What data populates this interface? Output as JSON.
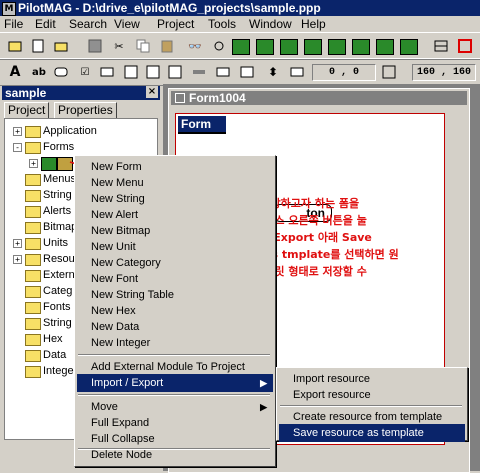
{
  "window": {
    "title": "PilotMAG - D:\\drive_e\\pilotMAG_projects\\sample.ppp"
  },
  "menubar": [
    "File",
    "Edit",
    "Search",
    "View",
    "Project",
    "Tools",
    "Window",
    "Help"
  ],
  "toolbar2": {
    "coord1": "0 , 0",
    "coord2": "160 , 160"
  },
  "panel": {
    "title": "sample",
    "tabs": [
      "Project",
      "Properties"
    ],
    "tree": [
      "Application",
      "Forms",
      "",
      "Menus",
      "String",
      "Alerts",
      "Bitmap",
      "Units",
      "Resour",
      "Externa",
      "Categ",
      "Fonts",
      "String",
      "Hex",
      "Data",
      "Intege"
    ]
  },
  "form": {
    "window_title": "Form1004",
    "header": "Form",
    "button_fragment": "ton"
  },
  "context_menu": {
    "items": [
      "New Form",
      "New Menu",
      "New String",
      "New Alert",
      "New Bitmap",
      "New Unit",
      "New Category",
      "New Font",
      "New String Table",
      "New Hex",
      "New Data",
      "New Integer",
      "Add External Module To Project",
      "Import / Export",
      "Move",
      "Full Expand",
      "Full Collapse",
      "Delete Node"
    ]
  },
  "submenu": {
    "items": [
      "Import resource",
      "Export resource",
      "Create resource from template",
      "Save resource as template"
    ]
  },
  "annotation": {
    "lines": [
      "템플릿으로 저장하고자 하는 폼을",
      "선택한 뒤 마우스 오른쪽 버튼을 눌",
      "러 Import / Export 아래 Save",
      "resource as tmplate를 선택하면 원",
      "하는 폼을 템플릿 형태로 저장할 수",
      "있다."
    ]
  },
  "colors": {
    "titlebar": "#0a246a",
    "annotation": "#e01010",
    "highlight": "#0a246a"
  }
}
